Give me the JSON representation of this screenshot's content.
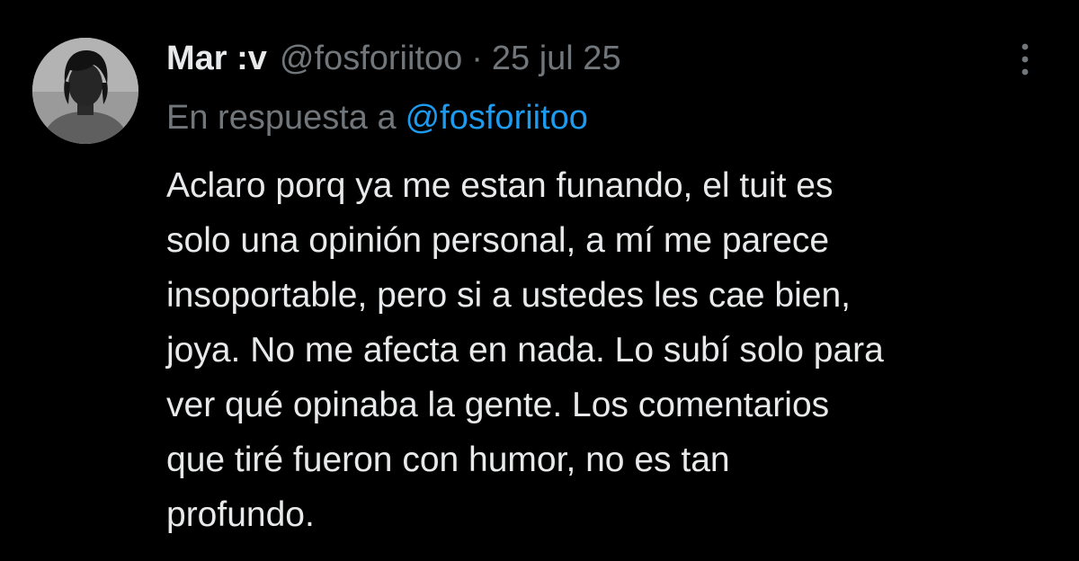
{
  "tweet": {
    "display_name": "Mar :v",
    "handle": "@fosforiitoo",
    "separator": "·",
    "date": "25 jul 25",
    "reply_prefix": "En respuesta a",
    "reply_handle": "@fosforiitoo",
    "body_lines": [
      "Aclaro porq ya me estan funando, el tuit es",
      "solo una opinión personal, a mí me parece",
      "insoportable, pero si a ustedes les cae bien,",
      "joya. No me afecta en nada. Lo subí solo para",
      "ver qué opinaba la gente. Los comentarios",
      "que tiré fueron con humor, no es tan",
      "profundo."
    ]
  },
  "icons": {
    "avatar": "profile-photo",
    "more": "more-vertical-icon"
  },
  "colors": {
    "background": "#000000",
    "primary_text": "#e7e9ea",
    "secondary_text": "#71767b",
    "link": "#1d9bf0"
  }
}
